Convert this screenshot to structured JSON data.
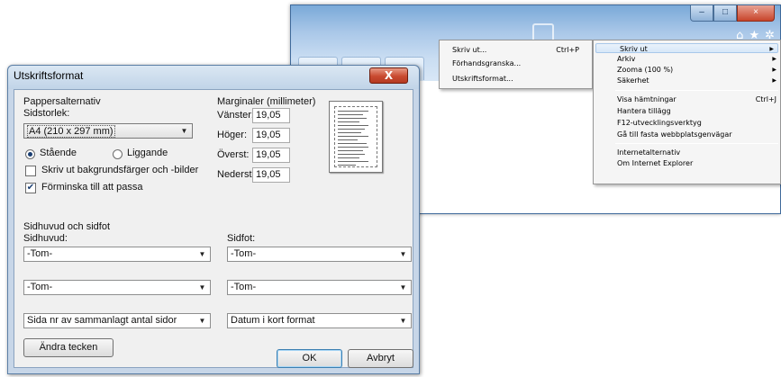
{
  "ie_window": {
    "controls": {
      "minimize": "–",
      "maximize": "□",
      "close": "×"
    },
    "toolbar_icons": [
      "home-icon",
      "favorites-icon",
      "tools-icon"
    ]
  },
  "print_submenu": {
    "items": [
      {
        "label": "Skriv ut...",
        "shortcut": "Ctrl+P"
      },
      {
        "label": "Förhandsgranska..."
      },
      {
        "label": "Utskriftsformat..."
      }
    ]
  },
  "tools_menu": {
    "items": [
      {
        "label": "Skriv ut"
      },
      {
        "label": "Arkiv"
      },
      {
        "label": "Zooma (100 %)"
      },
      {
        "label": "Säkerhet"
      },
      {
        "label": "Visa hämtningar",
        "shortcut": "Ctrl+J"
      },
      {
        "label": "Hantera tillägg"
      },
      {
        "label": "F12-utvecklingsverktyg"
      },
      {
        "label": "Gå till fasta webbplatsgenvägar"
      },
      {
        "label": "Internetalternativ"
      },
      {
        "label": "Om Internet Explorer"
      }
    ]
  },
  "dialog": {
    "title": "Utskriftsformat",
    "close_glyph": "X",
    "paper_options_label": "Pappersalternativ",
    "page_size_label": "Sidstorlek:",
    "page_size_value": "A4 (210 x 297 mm)",
    "orientation": {
      "portrait": "Stående",
      "landscape": "Liggande",
      "selected": "portrait"
    },
    "print_background": {
      "label": "Skriv ut bakgrundsfärger och -bilder",
      "checked": false
    },
    "shrink_to_fit": {
      "label": "Förminska till att passa",
      "checked": true
    },
    "margins_label": "Marginaler (millimeter)",
    "margins": {
      "left": {
        "label": "Vänster:",
        "value": "19,05"
      },
      "right": {
        "label": "Höger:",
        "value": "19,05"
      },
      "top": {
        "label": "Överst:",
        "value": "19,05"
      },
      "bottom": {
        "label": "Nederst:",
        "value": "19,05"
      }
    },
    "header_footer_label": "Sidhuvud och sidfot",
    "header_label": "Sidhuvud:",
    "footer_label": "Sidfot:",
    "header_selects": [
      "-Tom-",
      "-Tom-",
      "Sida nr av sammanlagt antal sidor"
    ],
    "footer_selects": [
      "-Tom-",
      "-Tom-",
      "Datum i kort format"
    ],
    "change_font_button": "Ändra tecken",
    "ok_button": "OK",
    "cancel_button": "Avbryt"
  }
}
